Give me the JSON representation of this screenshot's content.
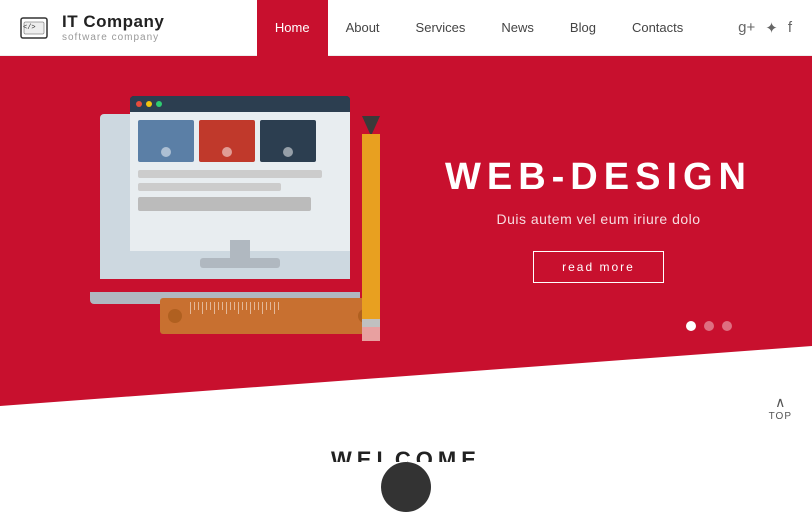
{
  "header": {
    "logo_title": "IT Company",
    "logo_subtitle": "software company",
    "nav_items": [
      "Home",
      "About",
      "Services",
      "News",
      "Blog",
      "Contacts"
    ],
    "active_nav": "Home",
    "social_icons": [
      "g+",
      "t",
      "f"
    ]
  },
  "hero": {
    "heading": "WEB-DESIGN",
    "subtext": "Duis autem vel eum iriure dolo",
    "button_label": "read more",
    "dots": [
      true,
      false,
      false
    ]
  },
  "welcome": {
    "heading": "WELCOME"
  },
  "top_button": {
    "label": "TOP"
  }
}
